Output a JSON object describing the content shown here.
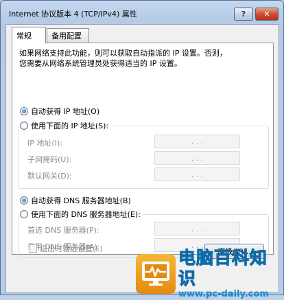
{
  "window": {
    "title": "Internet 协议版本 4 (TCP/IPv4) 属性",
    "help_glyph": "?",
    "close_glyph": "✕"
  },
  "tabs": [
    {
      "label": "常规",
      "selected": true
    },
    {
      "label": "备用配置",
      "selected": false
    }
  ],
  "general": {
    "intro_line1": "如果网络支持此功能，则可以获取自动指派的 IP 设置。否则，",
    "intro_line2": "您需要从网络系统管理员处获得适当的 IP 设置。",
    "ip_auto_label": "自动获得 IP 地址(O)",
    "ip_manual_label": "使用下面的 IP 地址(S):",
    "ip_fields": [
      {
        "label": "IP 地址(I):",
        "value": ". . ."
      },
      {
        "label": "子网掩码(U):",
        "value": ". . ."
      },
      {
        "label": "默认网关(D):",
        "value": ". . ."
      }
    ],
    "dns_auto_label": "自动获得 DNS 服务器地址(B)",
    "dns_manual_label": "使用下面的 DNS 服务器地址(E):",
    "dns_fields": [
      {
        "label": "首选 DNS 服务器(P):",
        "value": ". . ."
      },
      {
        "label": "备用 DNS 服务器(A):",
        "value": ". . ."
      }
    ],
    "validate_label": "退出时验证设置(L)",
    "advanced_label": "高级(V)..."
  },
  "watermark": {
    "title": "电脑百科知识",
    "url": "www.pc-daily.com"
  }
}
